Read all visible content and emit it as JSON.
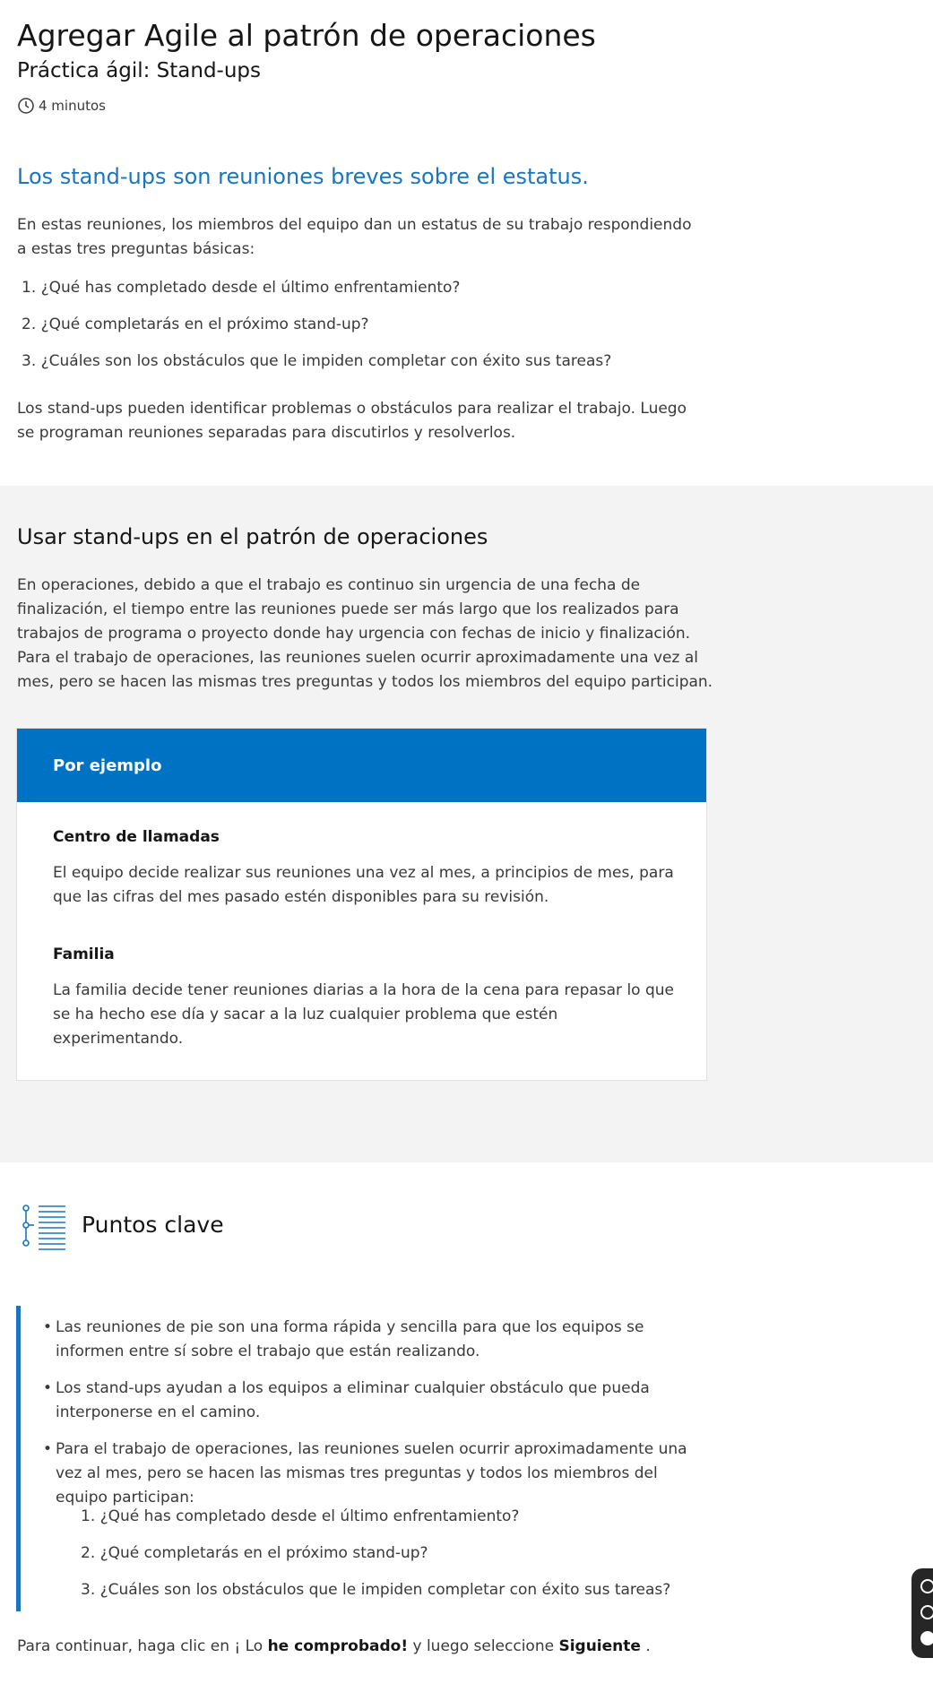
{
  "header": {
    "title": "Agregar Agile al patrón de operaciones",
    "subtitle": "Práctica ágil: Stand-ups",
    "duration": "4 minutos",
    "duration_icon": "clock-icon"
  },
  "intro": {
    "heading": "Los stand-ups son reuniones breves sobre el estatus.",
    "paragraph": "En estas reuniones, los miembros del equipo dan un estatus de su trabajo respondiendo a estas tres preguntas básicas:",
    "questions": [
      "1. ¿Qué has completado desde el último enfrentamiento?",
      "2. ¿Qué completarás en el próximo stand-up?",
      "3. ¿Cuáles son los obstáculos que le impiden completar con éxito sus tareas?"
    ],
    "closing": "Los stand-ups pueden identificar problemas o obstáculos para realizar el trabajo. Luego se programan reuniones separadas para discutirlos y resolverlos."
  },
  "operations": {
    "heading": "Usar stand-ups en el patrón de operaciones",
    "paragraph": "En operaciones, debido a que el trabajo es continuo sin urgencia de una fecha de finalización, el tiempo entre las reuniones puede ser más largo que los realizados para trabajos de programa o proyecto donde hay urgencia con fechas de inicio y finalización. Para el trabajo de operaciones, las reuniones suelen ocurrir aproximadamente una vez al mes, pero se hacen las mismas tres preguntas y todos los miembros del equipo participan.",
    "example": {
      "header": "Por ejemplo",
      "items": [
        {
          "title": "Centro de llamadas",
          "text": "El equipo decide realizar sus reuniones una vez al mes, a principios de mes, para que las cifras del mes pasado estén disponibles para su revisión."
        },
        {
          "title": "Familia",
          "text": "La familia decide tener reuniones diarias a la hora de la cena para repasar lo que se ha hecho ese día y sacar a la luz cualquier problema que estén experimentando."
        }
      ]
    }
  },
  "key_points": {
    "title": "Puntos clave",
    "icon": "key-points-icon",
    "bullets": [
      "Las reuniones de pie son una forma rápida y sencilla para que los equipos se informen entre sí sobre el trabajo que están realizando.",
      "Los stand-ups ayudan a los equipos a eliminar cualquier obstáculo que pueda interponerse en el camino.",
      "Para el trabajo de operaciones, las reuniones suelen ocurrir aproximadamente una vez al mes, pero se hacen las mismas tres preguntas y todos los miembros del equipo participan:"
    ],
    "sub_questions": [
      "1. ¿Qué has completado desde el último enfrentamiento?",
      "2. ¿Qué completarás en el próximo stand-up?",
      "3. ¿Cuáles son los obstáculos que le impiden completar con éxito sus tareas?"
    ]
  },
  "continue_text": {
    "pre": "Para continuar, haga clic en ¡ Lo ",
    "bold1": "he comprobado!",
    "mid": " y luego seleccione ",
    "bold2": "Siguiente",
    "post": " ."
  },
  "colors": {
    "accent": "#1b74c0",
    "example_header": "#0072c3",
    "section_bg": "#f3f3f3"
  }
}
